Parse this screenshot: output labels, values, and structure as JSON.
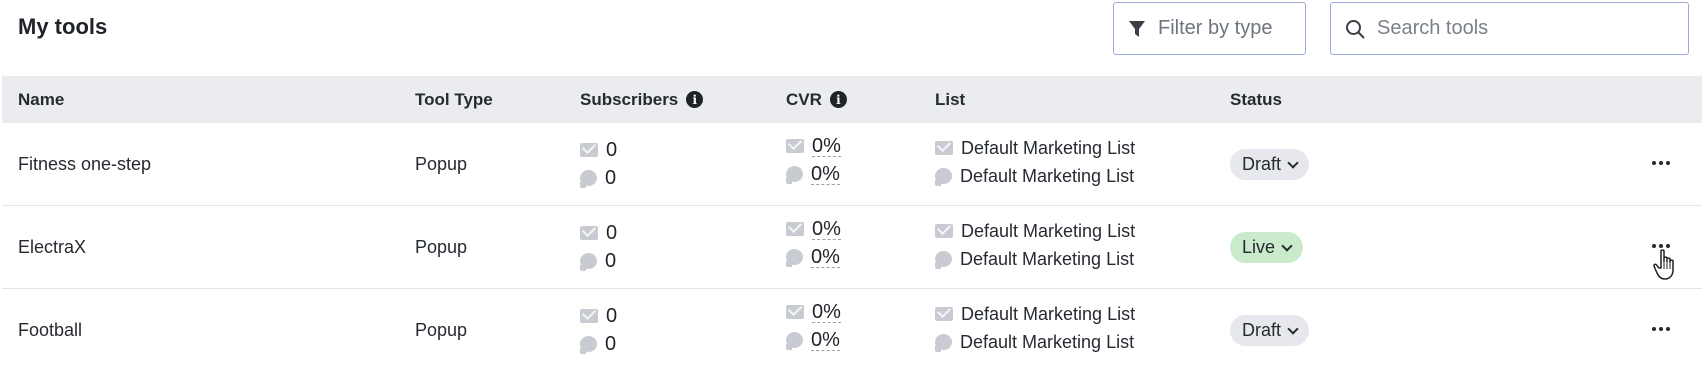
{
  "page": {
    "title": "My tools"
  },
  "toolbar": {
    "filter_label": "Filter by type",
    "search_placeholder": "Search tools"
  },
  "table": {
    "headers": {
      "name": "Name",
      "tool_type": "Tool Type",
      "subscribers": "Subscribers",
      "cvr": "CVR",
      "list": "List",
      "status": "Status"
    },
    "rows": [
      {
        "name": "Fitness one-step",
        "tool_type": "Popup",
        "subscribers_email": "0",
        "subscribers_sms": "0",
        "cvr_email": "0%",
        "cvr_sms": "0%",
        "list_email": "Default Marketing List",
        "list_sms": "Default Marketing List",
        "status": "Draft"
      },
      {
        "name": "ElectraX",
        "tool_type": "Popup",
        "subscribers_email": "0",
        "subscribers_sms": "0",
        "cvr_email": "0%",
        "cvr_sms": "0%",
        "list_email": "Default Marketing List",
        "list_sms": "Default Marketing List",
        "status": "Live"
      },
      {
        "name": "Football",
        "tool_type": "Popup",
        "subscribers_email": "0",
        "subscribers_sms": "0",
        "cvr_email": "0%",
        "cvr_sms": "0%",
        "list_email": "Default Marketing List",
        "list_sms": "Default Marketing List",
        "status": "Draft"
      }
    ]
  },
  "icons": {
    "filter": "filter-icon",
    "search": "search-icon",
    "info": "info-icon",
    "email": "mail-icon",
    "sms": "chat-icon",
    "more": "more-horizontal-icon",
    "cursor": "hand-pointer-icon"
  },
  "colors": {
    "header_bg": "#ebecf0",
    "draft_bg": "#e7e8ed",
    "live_bg": "#c9eacb",
    "input_border": "#9da9d9"
  }
}
